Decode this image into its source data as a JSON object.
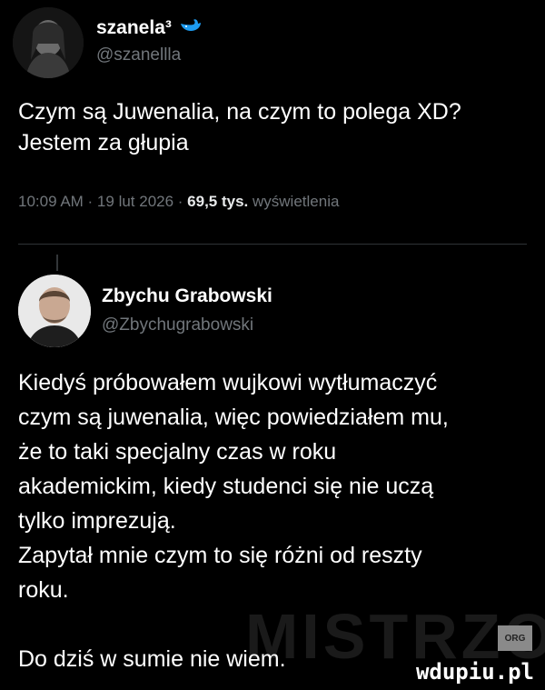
{
  "tweet1": {
    "display_name": "szanela³",
    "badge_icon": "whale-icon",
    "handle": "@szanellla",
    "text": "Czym są Juwenalia, na czym to polega XD?\nJestem za głupia",
    "time": "10:09 AM · 19 lut 2026 · ",
    "views": "69,5 tys.",
    "views_label": " wyświetlenia"
  },
  "tweet2": {
    "display_name": "Zbychu Grabowski",
    "handle": "@Zbychugrabowski",
    "text": "Kiedyś próbowałem wujkowi wytłumaczyć\nczym są juwenalia, więc powiedziałem mu,\nże to taki specjalny czas w roku\nakademickim, kiedy studenci się nie uczą\ntylko imprezują.\nZapytał mnie czym to się różni od reszty\nroku.\n\nDo dziś w sumie nie wiem."
  },
  "watermark": {
    "text": "MISTRZOWIE",
    "org": "ORG",
    "site": "wdupiu.pl"
  },
  "colors": {
    "background": "#000000",
    "text": "#ffffff",
    "secondary": "#71767b",
    "badge_blue": "#1d9bf0"
  }
}
